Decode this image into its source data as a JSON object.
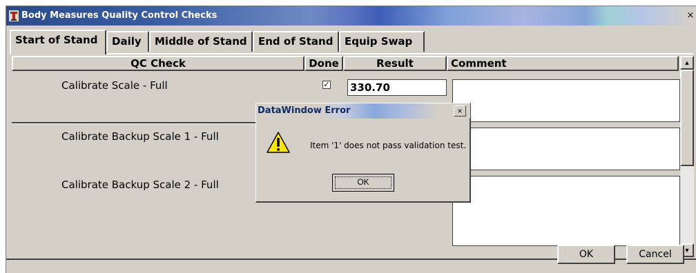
{
  "window": {
    "title": "Body Measures Quality Control Checks",
    "close_glyph": "×",
    "icon": "app-icon"
  },
  "tabs": [
    {
      "label": "Start of Stand",
      "active": true
    },
    {
      "label": "Daily",
      "active": false
    },
    {
      "label": "Middle of Stand",
      "active": false
    },
    {
      "label": "End of Stand",
      "active": false
    },
    {
      "label": "Equip Swap",
      "active": false
    }
  ],
  "grid": {
    "headers": {
      "qc_check": "QC Check",
      "done": "Done",
      "result": "Result",
      "comment": "Comment"
    },
    "rows": [
      {
        "qc_check": "Calibrate Scale - Full",
        "done": true,
        "result": "330.70",
        "comment": ""
      },
      {
        "qc_check": "Calibrate Backup Scale 1 - Full",
        "done": false,
        "result": "",
        "comment": ""
      },
      {
        "qc_check": "Calibrate Backup Scale 2 - Full",
        "done": false,
        "result": "",
        "comment": ""
      }
    ]
  },
  "buttons": {
    "ok": "OK",
    "cancel": "Cancel"
  },
  "dialog": {
    "title": "DataWindow Error",
    "message": "Item '1' does not pass validation test.",
    "ok": "OK",
    "icon": "warning-icon",
    "close_glyph": "×"
  },
  "scrollbar": {
    "up_glyph": "▲",
    "down_glyph": "▼"
  },
  "checkmark": "✓"
}
